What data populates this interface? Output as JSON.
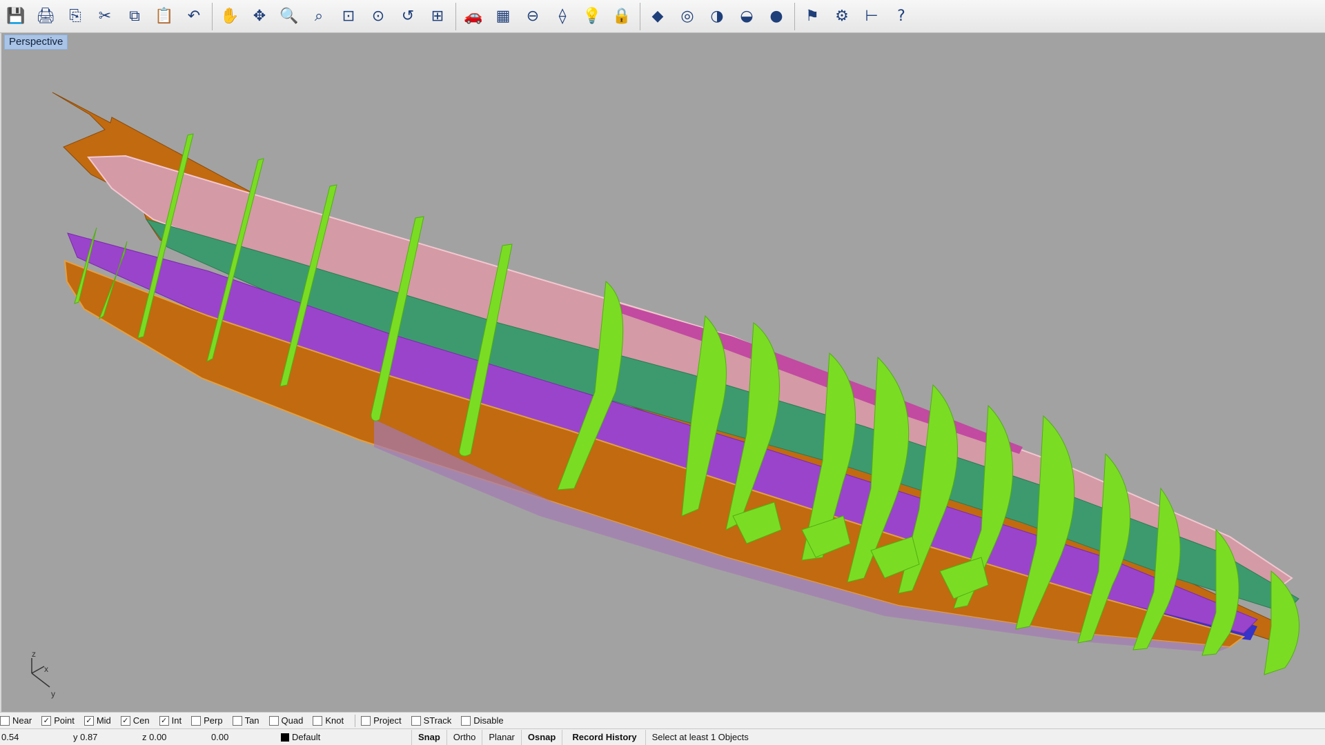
{
  "toolbar": {
    "buttons": [
      {
        "name": "save-icon",
        "glyph": "💾"
      },
      {
        "name": "print-icon",
        "glyph": "🖨"
      },
      {
        "name": "export-icon",
        "glyph": "⎘"
      },
      {
        "name": "cut-icon",
        "glyph": "✂"
      },
      {
        "name": "copy-icon",
        "glyph": "⧉"
      },
      {
        "name": "paste-icon",
        "glyph": "📋"
      },
      {
        "name": "undo-icon",
        "glyph": "↶"
      },
      {
        "name": "pan-hand-icon",
        "glyph": "✋"
      },
      {
        "name": "rotate-view-icon",
        "glyph": "✥"
      },
      {
        "name": "zoom-icon",
        "glyph": "🔍"
      },
      {
        "name": "zoom-window-icon",
        "glyph": "⌕"
      },
      {
        "name": "zoom-extents-icon",
        "glyph": "⊡"
      },
      {
        "name": "zoom-selected-icon",
        "glyph": "⊙"
      },
      {
        "name": "undo-view-icon",
        "glyph": "↺"
      },
      {
        "name": "viewport-layout-icon",
        "glyph": "⊞"
      },
      {
        "name": "car-icon",
        "glyph": "🚗"
      },
      {
        "name": "grid-plane-icon",
        "glyph": "▦"
      },
      {
        "name": "point-icon",
        "glyph": "⊖"
      },
      {
        "name": "snap-shapes-icon",
        "glyph": "⟠"
      },
      {
        "name": "light-bulb-icon",
        "glyph": "💡"
      },
      {
        "name": "lock-icon",
        "glyph": "🔒"
      },
      {
        "name": "material-icon",
        "glyph": "◆"
      },
      {
        "name": "color-wheel-icon",
        "glyph": "◎"
      },
      {
        "name": "shaded-sphere-icon",
        "glyph": "◑"
      },
      {
        "name": "render-sphere-icon",
        "glyph": "◒"
      },
      {
        "name": "blue-sphere-icon",
        "glyph": "●"
      },
      {
        "name": "analyze-icon",
        "glyph": "⚑"
      },
      {
        "name": "options-gear-icon",
        "glyph": "⚙"
      },
      {
        "name": "dimension-icon",
        "glyph": "⊢"
      },
      {
        "name": "help-icon",
        "glyph": "?"
      }
    ]
  },
  "viewport": {
    "title": "Perspective",
    "axis_labels": {
      "z": "z",
      "x": "x",
      "y": "y"
    },
    "background": "#a2a2a2"
  },
  "colors": {
    "orange": "#c26a10",
    "pink": "#d49aa6",
    "green": "#3d9a6e",
    "purple": "#9a44cc",
    "blue": "#3533c8",
    "frame_green": "#7bdc24",
    "magenta": "#c24aa0"
  },
  "osnap": {
    "items": [
      {
        "label": "Near",
        "checked": false
      },
      {
        "label": "Point",
        "checked": true
      },
      {
        "label": "Mid",
        "checked": true
      },
      {
        "label": "Cen",
        "checked": true
      },
      {
        "label": "Int",
        "checked": true
      },
      {
        "label": "Perp",
        "checked": false
      },
      {
        "label": "Tan",
        "checked": false
      },
      {
        "label": "Quad",
        "checked": false
      },
      {
        "label": "Knot",
        "checked": false
      }
    ],
    "extra": [
      {
        "label": "Project",
        "checked": false
      },
      {
        "label": "STrack",
        "checked": false
      },
      {
        "label": "Disable",
        "checked": false
      }
    ]
  },
  "status": {
    "x": "0.54",
    "y": "y 0.87",
    "z": "z 0.00",
    "distance": "0.00",
    "layer": "Default",
    "snap": "Snap",
    "ortho": "Ortho",
    "planar": "Planar",
    "osnap": "Osnap",
    "record_history": "Record History",
    "prompt": "Select at least 1 Objects"
  }
}
